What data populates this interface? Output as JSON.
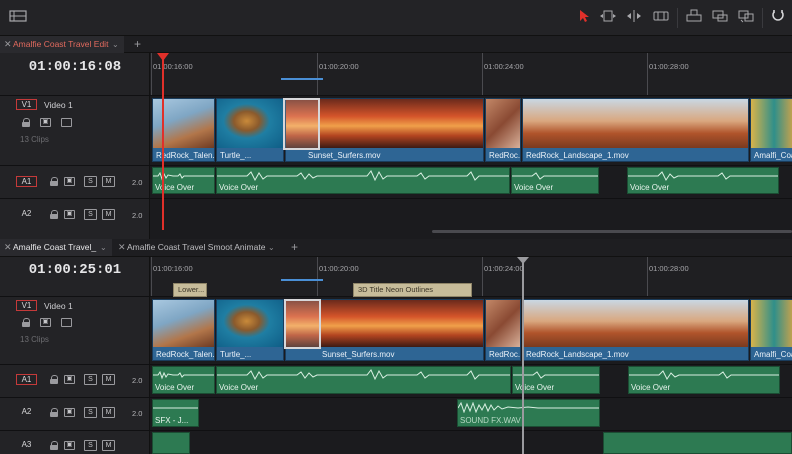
{
  "toolbar": {
    "icons": [
      "layout-icon",
      "select-arrow-icon",
      "trim-icon",
      "dynamic-trim-icon",
      "blade-icon",
      "insert-icon",
      "overwrite-icon",
      "replace-icon",
      "snapping-icon"
    ]
  },
  "top_timeline": {
    "tab_label": "Amalfie Coast Travel Edit",
    "timecode": "01:00:16:08",
    "ruler": [
      "01:00:16:00",
      "01:00:20:00",
      "01:00:24:00",
      "01:00:28:00"
    ],
    "tracks": {
      "v1": {
        "badge": "V1",
        "name": "Video 1",
        "clips_count": "13 Clips"
      },
      "a1": {
        "badge": "A1",
        "level": "2.0"
      },
      "a2": {
        "badge": "A2",
        "level": "2.0"
      }
    },
    "video_clips": [
      "RedRock_Talen...",
      "Turtle_...",
      "Sunset_Surfers.mov",
      "RedRoc...",
      "RedRock_Landscape_1.mov",
      "Amalfi_Coas..."
    ],
    "audio_clips": [
      "Voice Over",
      "Voice Over",
      "Voice Over",
      "Voice Over"
    ]
  },
  "bottom_timeline": {
    "tabs": [
      "Amalfie Coast Travel_",
      "Amalfie Coast Travel Smoot Animate"
    ],
    "timecode": "01:00:25:01",
    "ruler": [
      "01:00:16:00",
      "01:00:20:00",
      "01:00:24:00",
      "01:00:28:00"
    ],
    "tracks": {
      "v1": {
        "badge": "V1",
        "name": "Video 1",
        "clips_count": "13 Clips"
      },
      "a1": {
        "badge": "A1",
        "level": "2.0"
      },
      "a2": {
        "badge": "A2",
        "level": "2.0"
      },
      "a3": {
        "badge": "A3"
      }
    },
    "title_clips": [
      "Lower...",
      "3D Title Neon Outlines"
    ],
    "video_clips": [
      "RedRock_Talen...",
      "Turtle_...",
      "Sunset_Surfers.mov",
      "RedRoc...",
      "RedRock_Landscape_1.mov",
      "Amalfi_Coas..."
    ],
    "audio_clips_a1": [
      "Voice Over",
      "Voice Over",
      "Voice Over",
      "Voice Over"
    ],
    "audio_clips_a2": [
      "SFX - J...",
      "SOUND FX.WAV"
    ]
  },
  "controls": {
    "solo": "S",
    "mute": "M"
  },
  "colors": {
    "playhead_top": "#e0302a",
    "playhead_bottom": "#9a9a9e",
    "video_clip": "#2e6594",
    "audio_clip": "#2d7a52",
    "title_clip": "#c7bc9a",
    "track_badge_border": "#c43a3a",
    "ruler_marker": "#4a8fd6"
  }
}
